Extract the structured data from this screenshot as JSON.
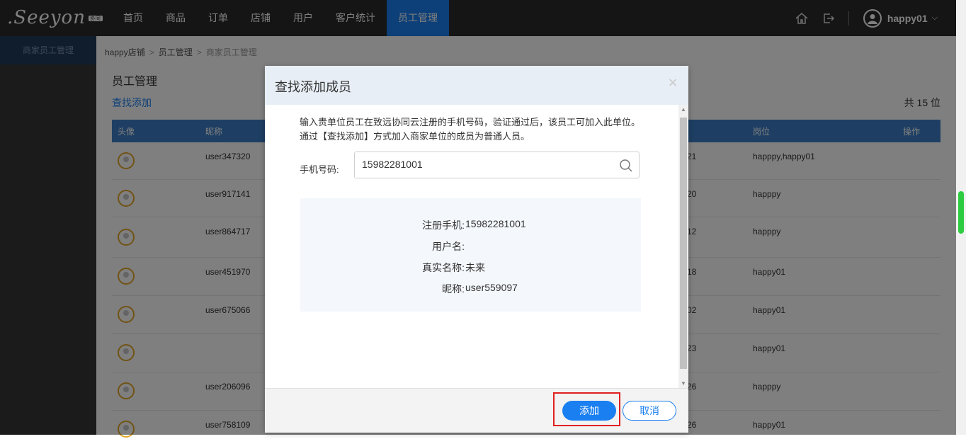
{
  "app": {
    "logo_text": ".Seeyon",
    "logo_badge": "协同"
  },
  "nav": {
    "items": [
      {
        "label": "首页"
      },
      {
        "label": "商品"
      },
      {
        "label": "订单"
      },
      {
        "label": "店铺"
      },
      {
        "label": "用户"
      },
      {
        "label": "客户统计"
      },
      {
        "label": "员工管理"
      }
    ],
    "active": "员工管理",
    "user": "happy01"
  },
  "sidebar": {
    "items": [
      {
        "label": "商家员工管理"
      }
    ]
  },
  "breadcrumb": [
    "happy店铺",
    "员工管理",
    "商家员工管理"
  ],
  "page": {
    "title": "员工管理",
    "link": "查找添加",
    "count": "共 15 位"
  },
  "table": {
    "headers": [
      "头像",
      "昵称",
      "",
      "岗位",
      "操作"
    ],
    "rows": [
      {
        "nick": "user347320",
        "date": "21",
        "post": "happpy,happy01"
      },
      {
        "nick": "user917141",
        "date": "20",
        "post": "happpy"
      },
      {
        "nick": "user864717",
        "date": "12",
        "post": "happpy"
      },
      {
        "nick": "user451970",
        "date": "18",
        "post": "happy01"
      },
      {
        "nick": "user675066",
        "date": "02",
        "post": "happy01"
      },
      {
        "nick": "",
        "date": "23",
        "post": "happy01"
      },
      {
        "nick": "user206096",
        "date": "26",
        "post": "happpy"
      },
      {
        "nick": "user758109",
        "date": "26",
        "post": "happy01"
      }
    ]
  },
  "dialog": {
    "title": "查找添加成员",
    "intro": "输入贵单位员工在致远协同云注册的手机号码，验证通过后，该员工可加入此单位。 通过【查找添加】方式加入商家单位的成员为普通人员。",
    "phone_label": "手机号码:",
    "phone_value": "15982281001",
    "result": [
      {
        "label": "注册手机:",
        "value": "15982281001"
      },
      {
        "label": "用户名:",
        "value": ""
      },
      {
        "label": "真实名称:",
        "value": "未来"
      },
      {
        "label": "昵称:",
        "value": "user559097"
      }
    ],
    "add_label": "添加",
    "cancel_label": "取消"
  }
}
